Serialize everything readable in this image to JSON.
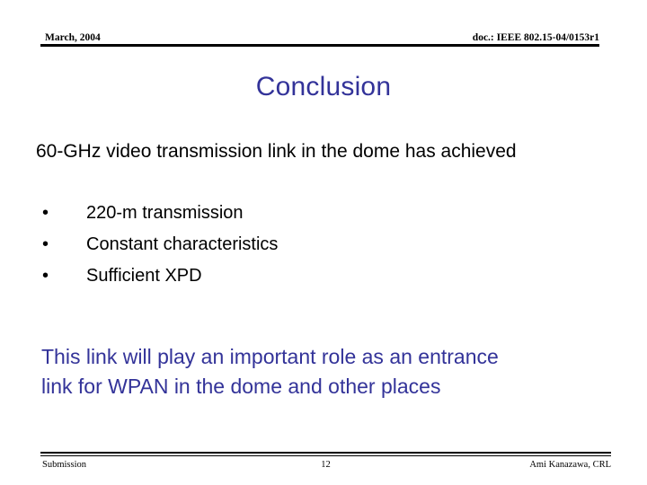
{
  "header": {
    "date": "March, 2004",
    "doc": "doc.: IEEE 802.15-04/0153r1"
  },
  "title": "Conclusion",
  "body": {
    "lead": "60-GHz video transmission link in the dome has achieved",
    "bullet_marker": "•",
    "bullets": [
      "220-m transmission",
      "Constant characteristics",
      "Sufficient XPD"
    ],
    "closing": {
      "line1": "This link will play an important role as an entrance",
      "line2": "link for WPAN in the dome and other places"
    }
  },
  "footer": {
    "left": "Submission",
    "page_number": "12",
    "right": "Ami Kanazawa, CRL"
  },
  "colors": {
    "accent": "#333399",
    "text": "#000000",
    "background": "#ffffff",
    "rule": "#000000"
  }
}
